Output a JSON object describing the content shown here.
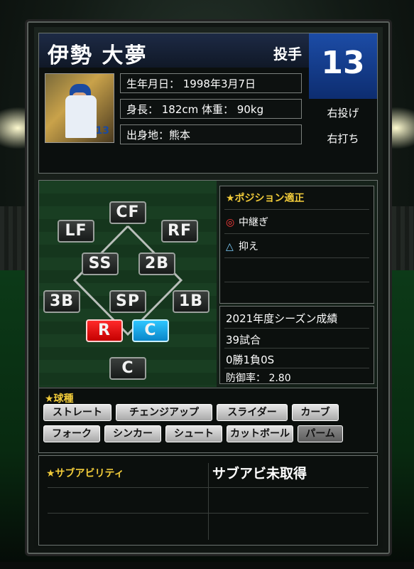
{
  "header": {
    "name": "伊勢 大夢",
    "position": "投手",
    "number": "13",
    "birth": "生年月日： 1998年3月7日",
    "body": "身長： 182cm 体重： 90kg",
    "hometown": "出身地：熊本",
    "throws": "右投げ",
    "bats": "右打ち",
    "photo_jersey": "13"
  },
  "field": {
    "positions": [
      "CF",
      "LF",
      "RF",
      "SS",
      "2B",
      "3B",
      "SP",
      "1B",
      "R",
      "C",
      "C"
    ]
  },
  "aptitude": {
    "title": "★ポジション適正",
    "items": [
      {
        "mark": "◎",
        "label": "中継ぎ"
      },
      {
        "mark": "△",
        "label": "抑え"
      }
    ]
  },
  "season": {
    "title": "2021年度シーズン成績",
    "games": "39試合",
    "record": "0勝1負0S",
    "era": "防御率： 2.80"
  },
  "pitches": {
    "title": "★球種",
    "items": [
      "ストレート",
      "チェンジアップ",
      "スライダー",
      "カーブ",
      "フォーク",
      "シンカー",
      "シュート",
      "カットボール",
      "パーム"
    ]
  },
  "sub_ability": {
    "title": "★サブアビリティ",
    "status": "サブアビ未取得"
  },
  "colors": {
    "accent_gold": "#f2cc3a",
    "number_blue": "#1c4ca6",
    "red_pos": "#ff2a2a",
    "blue_pos": "#2ec6ff"
  }
}
